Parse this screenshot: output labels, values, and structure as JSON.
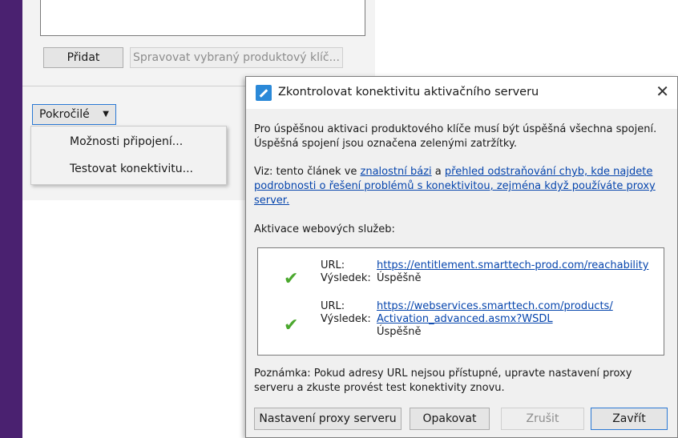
{
  "main": {
    "add_button": "Přidat",
    "manage_button": "Spravovat vybraný produktový klíč...",
    "advanced_button": "Pokročilé",
    "menu": [
      "Možnosti připojení...",
      "Testovat konektivitu..."
    ]
  },
  "dialog": {
    "title": "Zkontrolovat konektivitu aktivačního serveru",
    "intro_line1": "Pro úspěšnou aktivaci produktového klíče musí být úspěšná všechna spojení.",
    "intro_line2": "Úspěšná spojení jsou označena zelenými zatržítky.",
    "see_prefix": "Viz: tento článek ve",
    "kb_link": "znalostní bázi",
    "and_word": "a",
    "trouble_link_line1": "přehled odstraňování chyb, kde najdete",
    "trouble_link_line2": "podrobnosti o řešení problémů s konektivitou, zejména když používáte proxy",
    "trouble_link_line3": "server.",
    "section_label": "Aktivace webových služeb:",
    "results": [
      {
        "url_label": "URL:",
        "url": "https://entitlement.smarttech-prod.com/reachability",
        "result_label": "Výsledek:",
        "result": "Úspěšně"
      },
      {
        "url_label": "URL:",
        "url_line1": "https://webservices.smarttech.com/products/",
        "result_label": "Výsledek:",
        "url_line2": "Activation_advanced.asmx?WSDL",
        "result": "Úspěšně"
      }
    ],
    "note_line1": "Poznámka: Pokud adresy URL nejsou přístupné, upravte nastavení proxy",
    "note_line2": "serveru a zkuste provést test konektivity znovu.",
    "buttons": {
      "proxy": "Nastavení proxy serveru",
      "retry": "Opakovat",
      "cancel": "Zrušit",
      "close": "Zavřít"
    }
  }
}
